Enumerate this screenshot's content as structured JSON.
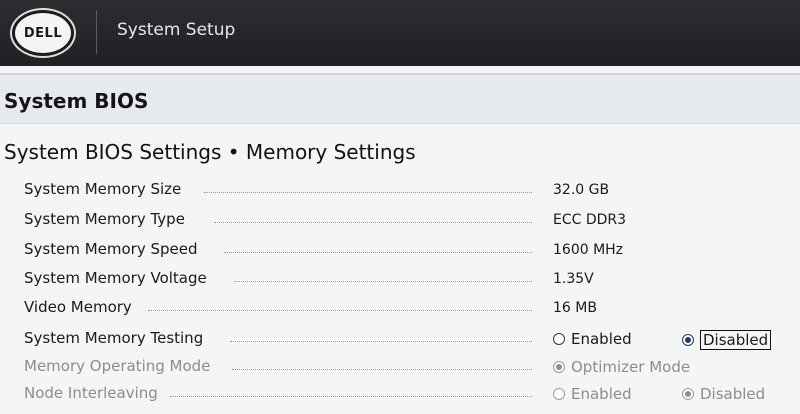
{
  "header": {
    "logo_text": "DELL",
    "app_title": "System Setup"
  },
  "section": {
    "title": "System BIOS"
  },
  "page": {
    "title": "System BIOS Settings • Memory Settings"
  },
  "settings": [
    {
      "label": "System Memory Size",
      "value": "32.0 GB"
    },
    {
      "label": "System Memory Type",
      "value": "ECC DDR3"
    },
    {
      "label": "System Memory Speed",
      "value": "1600 MHz"
    },
    {
      "label": "System Memory Voltage",
      "value": "1.35V"
    },
    {
      "label": "Video Memory",
      "value": "16 MB"
    },
    {
      "label": "System Memory Testing",
      "options": [
        "Enabled",
        "Disabled"
      ],
      "selected": "Disabled",
      "enabled": true
    },
    {
      "label": "Memory Operating Mode",
      "options": [
        "Optimizer Mode"
      ],
      "selected": "Optimizer Mode",
      "enabled": false
    },
    {
      "label": "Node Interleaving",
      "options": [
        "Enabled",
        "Disabled"
      ],
      "selected": "Disabled",
      "enabled": false
    }
  ],
  "colors": {
    "header_bg": "#1f2124",
    "band_bg": "#e6e9ee",
    "radio_selected": "#1f3c7a"
  }
}
